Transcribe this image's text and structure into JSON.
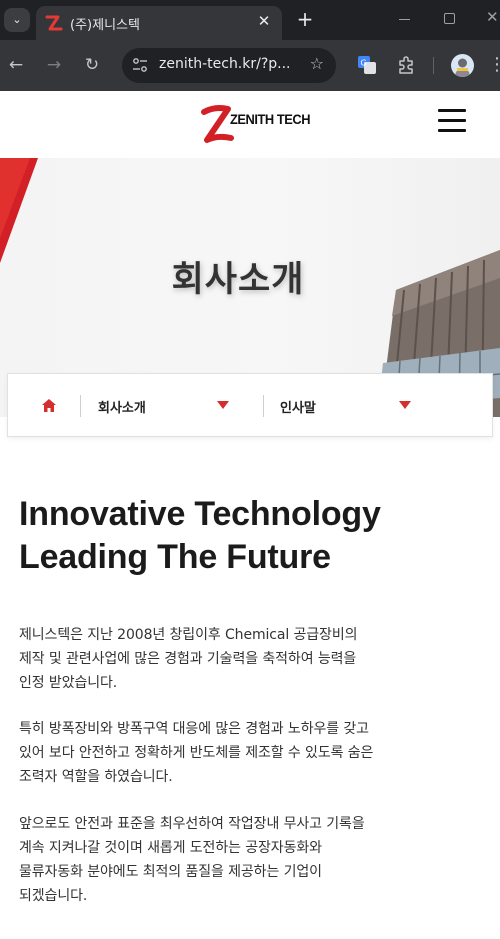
{
  "browser": {
    "tab": {
      "title": "(주)제니스텍",
      "close": "✕"
    },
    "new_tab": "+",
    "window": {
      "close": "✕"
    },
    "toolbar": {
      "back": "←",
      "forward": "→",
      "reload": "↻",
      "menu": "⋮"
    },
    "omnibox": {
      "url": "zenith-tech.kr/?p...",
      "star": "☆"
    },
    "colors": {
      "chrome_dark": "#202124",
      "chrome_mid": "#35363a"
    }
  },
  "site": {
    "logo": {
      "text": "ZENITH TECH",
      "accent": "#d32027"
    },
    "hero": {
      "title": "회사소개"
    },
    "location_nav": {
      "home_icon": "home-icon",
      "level1": "회사소개",
      "level2": "인사말",
      "caret_color": "#d32f2f"
    },
    "content": {
      "headline": [
        "Innovative Technology",
        "Leading The Future"
      ],
      "paragraphs": [
        [
          "제니스텍은 지난 2008년 창립이후 Chemical 공급장비의",
          "제작 및 관련사업에 많은 경험과 기술력을 축적하여 능력을",
          "인정 받았습니다."
        ],
        [
          "특히 방폭장비와 방폭구역 대응에 많은 경험과 노하우를 갖고",
          "있어 보다 안전하고 정확하게 반도체를 제조할 수 있도록 숨은",
          "조력자 역할을 하였습니다."
        ],
        [
          "앞으로도 안전과 표준을 최우선하여 작업장내 무사고 기록을",
          "계속 지켜나갈 것이며 새롭게 도전하는 공장자동화와",
          "물류자동화 분야에도 최적의 품질을 제공하는 기업이",
          "되겠습니다."
        ]
      ]
    }
  }
}
